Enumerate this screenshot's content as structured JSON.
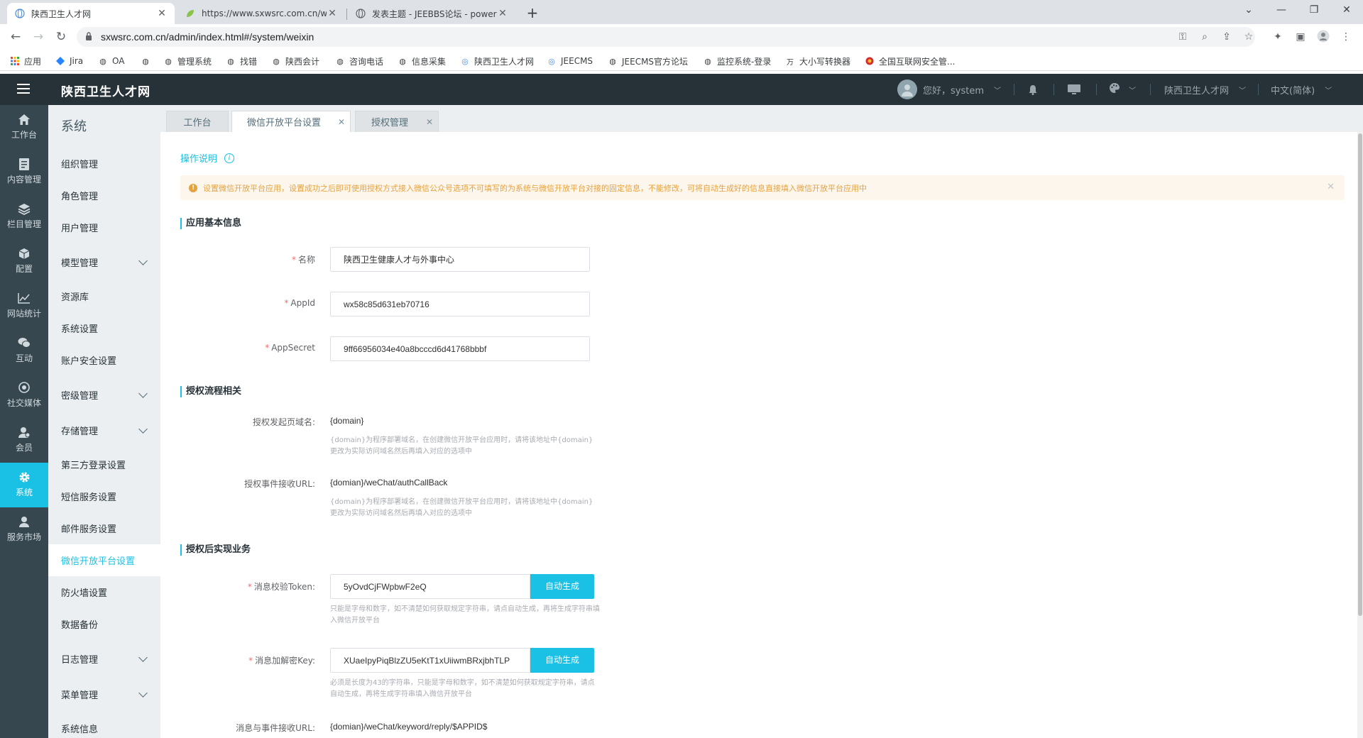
{
  "browser": {
    "tabs": [
      {
        "title": "陕西卫生人才网",
        "icon": "globe-icon"
      },
      {
        "title": "https://www.sxwsrc.com.cn/we",
        "icon": "leaf-icon"
      },
      {
        "title": "发表主题 - JEEBBS论坛 - power",
        "icon": "globe-icon"
      }
    ],
    "new_tab": "+",
    "url": "sxwsrc.com.cn/admin/index.html#/system/weixin",
    "bookmarks": [
      {
        "label": "应用",
        "icon": "apps-grid-icon"
      },
      {
        "label": "Jira",
        "icon": "jira-diamond-icon"
      },
      {
        "label": "OA",
        "icon": "globe-icon"
      },
      {
        "label": "",
        "icon": "globe-icon"
      },
      {
        "label": "管理系统",
        "icon": "globe-icon"
      },
      {
        "label": "找错",
        "icon": "globe-icon"
      },
      {
        "label": "陕西会计",
        "icon": "globe-icon"
      },
      {
        "label": "咨询电话",
        "icon": "globe-icon"
      },
      {
        "label": "信息采集",
        "icon": "globe-icon"
      },
      {
        "label": "陕西卫生人才网",
        "icon": "site-icon"
      },
      {
        "label": "JEECMS",
        "icon": "site-icon"
      },
      {
        "label": "JEECMS官方论坛",
        "icon": "globe-icon"
      },
      {
        "label": "监控系统-登录",
        "icon": "globe-icon"
      },
      {
        "label": "大小写转换器",
        "icon": "wan-icon"
      },
      {
        "label": "全国互联网安全管...",
        "icon": "police-badge-icon"
      }
    ]
  },
  "header": {
    "brand": "陕西卫生人才网",
    "user": "您好，system",
    "site_selector": "陕西卫生人才网",
    "language": "中文(简体)"
  },
  "rail": [
    {
      "label": "工作台",
      "icon": "home-icon"
    },
    {
      "label": "内容管理",
      "icon": "document-icon"
    },
    {
      "label": "栏目管理",
      "icon": "layers-icon"
    },
    {
      "label": "配置",
      "icon": "cube-icon"
    },
    {
      "label": "网站统计",
      "icon": "chart-line-icon"
    },
    {
      "label": "互动",
      "icon": "chat-icon"
    },
    {
      "label": "社交媒体",
      "icon": "target-icon"
    },
    {
      "label": "会员",
      "icon": "user-group-icon"
    },
    {
      "label": "系统",
      "icon": "gear-icon",
      "active": true
    },
    {
      "label": "服务市场",
      "icon": "person-icon"
    }
  ],
  "submenu": {
    "title": "系统",
    "items": [
      {
        "label": "组织管理"
      },
      {
        "label": "角色管理"
      },
      {
        "label": "用户管理"
      },
      {
        "label": "模型管理",
        "expandable": true
      },
      {
        "label": "资源库"
      },
      {
        "label": "系统设置"
      },
      {
        "label": "账户安全设置"
      },
      {
        "label": "密级管理",
        "expandable": true
      },
      {
        "label": "存储管理",
        "expandable": true
      },
      {
        "label": "第三方登录设置"
      },
      {
        "label": "短信服务设置"
      },
      {
        "label": "邮件服务设置"
      },
      {
        "label": "微信开放平台设置",
        "active": true
      },
      {
        "label": "防火墙设置"
      },
      {
        "label": "数据备份"
      },
      {
        "label": "日志管理",
        "expandable": true
      },
      {
        "label": "菜单管理",
        "expandable": true
      },
      {
        "label": "系统信息"
      }
    ]
  },
  "page_tabs": [
    {
      "label": "工作台",
      "closable": false
    },
    {
      "label": "微信开放平台设置",
      "closable": true,
      "active": true
    },
    {
      "label": "授权管理",
      "closable": true
    }
  ],
  "page": {
    "op_link": "操作说明",
    "alert": "设置微信开放平台应用，设置成功之后即可使用授权方式接入微信公众号选项不可填写的为系统与微信开放平台对接的固定信息，不能修改，可将自动生成好的信息直接填入微信开放平台应用中",
    "sections": {
      "basic": "应用基本信息",
      "flow": "授权流程相关",
      "biz": "授权后实现业务"
    },
    "fields": {
      "name": {
        "label": "名称",
        "value": "陕西卫生健康人才与外事中心"
      },
      "appid": {
        "label": "AppId",
        "value": "wx58c85d631eb70716"
      },
      "appsecret": {
        "label": "AppSecret",
        "value": "9ff66956034e40a8bcccd6d41768bbbf"
      },
      "auth_domain": {
        "label": "授权发起页域名:",
        "value": "{domain}",
        "hint": "{domain}为程序部署域名，在创建微信开放平台应用时，请将该地址中{domain}更改为实际访问域名然后再填入对应的选项中"
      },
      "auth_event": {
        "label": "授权事件接收URL:",
        "value": "{domian}/weChat/authCallBack",
        "hint": "{domain}为程序部署域名，在创建微信开放平台应用时，请将该地址中{domain}更改为实际访问域名然后再填入对应的选项中"
      },
      "token": {
        "label": "消息校验Token:",
        "value": "5yOvdCjFWpbwF2eQ",
        "button": "自动生成",
        "hint": "只能是字母和数字，如不清楚如何获取规定字符串，请点自动生成，再将生成字符串填入微信开放平台"
      },
      "aeskey": {
        "label": "消息加解密Key:",
        "value": "XUaeIpyPiqBlzZU5eKtT1xUiiwmBRxjbhTLP",
        "button": "自动生成",
        "hint": "必须是长度为43的字符串，只能是字母和数字，如不清楚如何获取规定字符串，请点自动生成，再将生成字符串填入微信开放平台"
      },
      "msg_url": {
        "label": "消息与事件接收URL:",
        "value": "{domian}/weChat/keyword/reply/$APPID$"
      }
    }
  }
}
